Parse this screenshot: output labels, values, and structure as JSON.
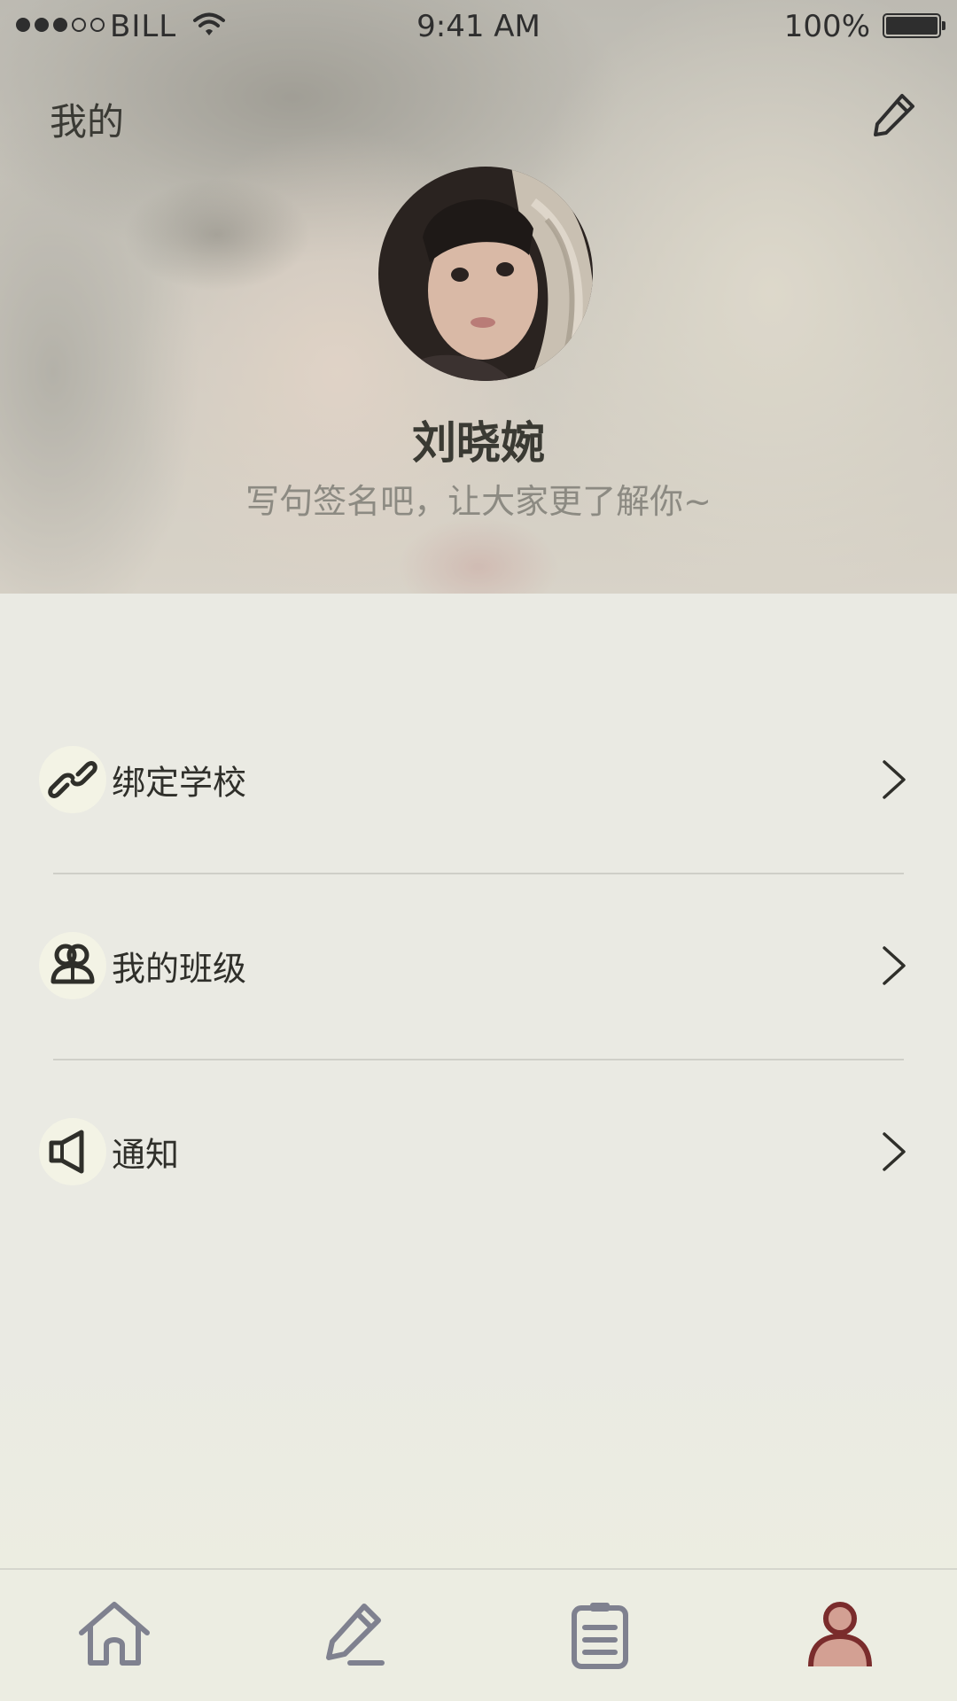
{
  "status_bar": {
    "carrier": "BILL",
    "time": "9:41 AM",
    "battery": "100%",
    "signal_bars_filled": 3,
    "signal_bars_total": 5
  },
  "header": {
    "title": "我的",
    "edit_icon": "pencil-icon"
  },
  "profile": {
    "name": "刘晓婉",
    "signature": "写句签名吧，让大家更了解你~"
  },
  "menu": {
    "items": [
      {
        "label": "绑定学校",
        "icon": "link-icon"
      },
      {
        "label": "我的班级",
        "icon": "people-icon"
      },
      {
        "label": "通知",
        "icon": "megaphone-icon"
      }
    ]
  },
  "tab_bar": {
    "tabs": [
      {
        "icon": "home-icon",
        "active": false
      },
      {
        "icon": "edit-icon",
        "active": false
      },
      {
        "icon": "clipboard-icon",
        "active": false
      },
      {
        "icon": "person-icon",
        "active": true
      }
    ]
  },
  "colors": {
    "tab_inactive": "#7f818f",
    "tab_active": "#7a2c2c",
    "tab_active_fill": "#d3a093",
    "background": "#eaeae3"
  }
}
